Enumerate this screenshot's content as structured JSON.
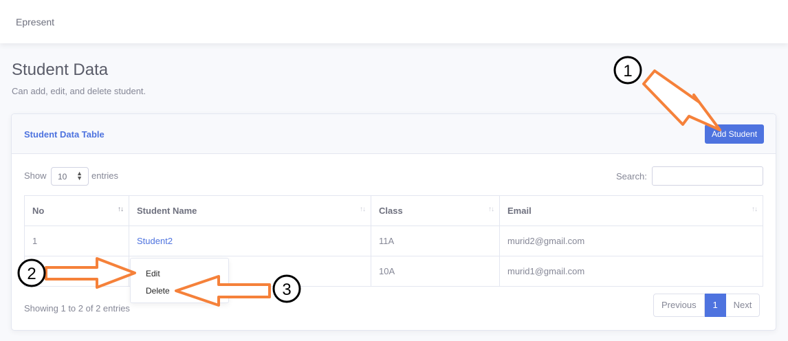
{
  "app": {
    "brand": "Epresent"
  },
  "page": {
    "title": "Student Data",
    "subtitle": "Can add, edit, and delete student."
  },
  "card": {
    "title": "Student Data Table",
    "add_button": "Add Student"
  },
  "table_controls": {
    "show_label": "Show",
    "entries_value": "10",
    "entries_label": "entries",
    "search_label": "Search:",
    "search_value": ""
  },
  "table": {
    "columns": [
      "No",
      "Student Name",
      "Class",
      "Email"
    ],
    "rows": [
      {
        "no": "1",
        "name": "Student2",
        "class": "11A",
        "email": "murid2@gmail.com"
      },
      {
        "no": "2",
        "name": "",
        "class": "10A",
        "email": "murid1@gmail.com"
      }
    ]
  },
  "footer": {
    "info": "Showing 1 to 2 of 2 entries",
    "previous": "Previous",
    "page": "1",
    "next": "Next"
  },
  "context_menu": {
    "edit": "Edit",
    "delete": "Delete"
  },
  "annotations": {
    "one": "1",
    "two": "2",
    "three": "3"
  },
  "colors": {
    "primary": "#4e73df",
    "arrow": "#f5813a"
  }
}
